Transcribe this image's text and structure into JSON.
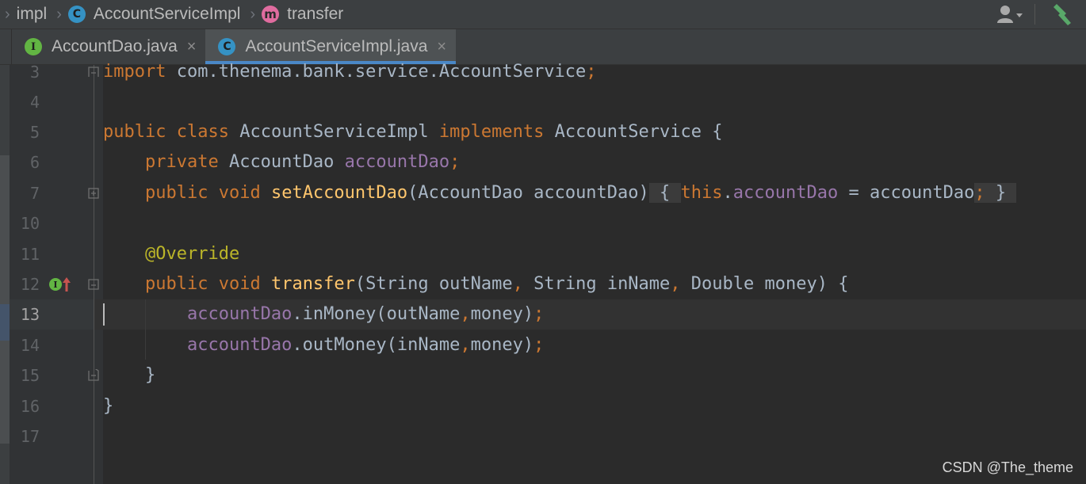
{
  "breadcrumb": {
    "items": [
      {
        "label": "impl",
        "icon": "package-icon"
      },
      {
        "label": "AccountServiceImpl",
        "icon": "class-icon",
        "badge": "C"
      },
      {
        "label": "transfer",
        "icon": "method-icon",
        "badge": "m"
      }
    ]
  },
  "tabs": [
    {
      "label": "AccountDao.java",
      "badge": "I",
      "active": false
    },
    {
      "label": "AccountServiceImpl.java",
      "badge": "C",
      "active": true
    }
  ],
  "editor": {
    "current_line": "13",
    "lines": [
      {
        "number": "3"
      },
      {
        "number": "4"
      },
      {
        "number": "5"
      },
      {
        "number": "6"
      },
      {
        "number": "7"
      },
      {
        "number": "10"
      },
      {
        "number": "11"
      },
      {
        "number": "12",
        "gutter_badge": "I"
      },
      {
        "number": "13"
      },
      {
        "number": "14"
      },
      {
        "number": "15"
      },
      {
        "number": "16"
      },
      {
        "number": "17"
      }
    ],
    "code": {
      "l3": {
        "kw": "import",
        "rest": " com.thenema.bank.service.AccountService",
        "semi": ";"
      },
      "l5": {
        "kw1": "public",
        "kw2": "class",
        "name": " AccountServiceImpl ",
        "kw3": "implements",
        "rest": " AccountService {"
      },
      "l6": {
        "kw": "private",
        "type": " AccountDao ",
        "field": "accountDao",
        "semi": ";"
      },
      "l7": {
        "kw1": "public",
        "kw2": "void",
        "fn": "setAccountDao",
        "params": "(AccountDao accountDao)",
        "brace_open": "{",
        "kw3": "this",
        "dot": ".",
        "field": "accountDao",
        "assign": " = accountDao",
        "semi": ";",
        "brace_close": "}"
      },
      "l11": {
        "ann": "@Override"
      },
      "l12": {
        "kw1": "public",
        "kw2": "void",
        "fn": "transfer",
        "p1": "(String outName",
        "c1": ",",
        "p2": " String inName",
        "c2": ",",
        "p3": " Double money) {"
      },
      "l13": {
        "field": "accountDao",
        "call": ".inMoney(outName",
        "comma": ",",
        "args": "money)",
        "semi": ";"
      },
      "l14": {
        "field": "accountDao",
        "call": ".outMoney(inName",
        "comma": ",",
        "args": "money)",
        "semi": ";"
      },
      "l15": {
        "text": "}"
      },
      "l16": {
        "text": "}"
      }
    }
  },
  "watermark": "CSDN @The_theme",
  "colors": {
    "keyword": "#cc7832",
    "method": "#ffc66d",
    "field": "#9876aa",
    "annotation": "#bbb529",
    "text": "#a9b7c6",
    "background": "#2b2b2b",
    "active_tab_underline": "#4a88c7"
  }
}
